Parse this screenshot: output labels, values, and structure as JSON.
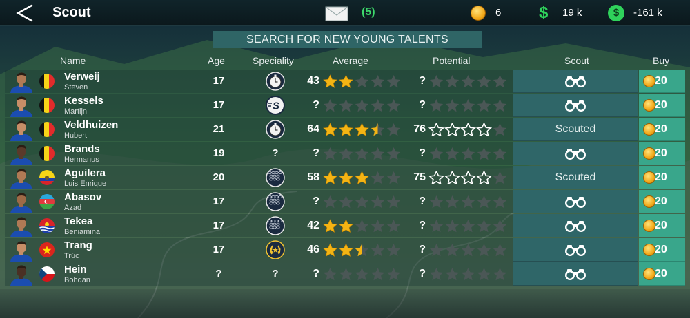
{
  "header": {
    "title": "Scout",
    "mail_count": "(5)",
    "coins": "6",
    "money": "19 k",
    "cash": "-161 k"
  },
  "search_button": "SEARCH FOR NEW YOUNG TALENTS",
  "columns": {
    "name": "Name",
    "age": "Age",
    "speciality": "Speciality",
    "average": "Average",
    "potential": "Potential",
    "scout": "Scout",
    "buy": "Buy"
  },
  "players": [
    {
      "last": "Verweij",
      "first": "Steven",
      "flag": "belgium",
      "age": "17",
      "spec": "stopwatch",
      "avg_value": "43",
      "avg_stars": 2,
      "pot_value": "?",
      "pot_stars": 0,
      "scout": "binoculars",
      "price": "20",
      "skin": "#b07a55",
      "shirt": "#1b4db0"
    },
    {
      "last": "Kessels",
      "first": "Martijn",
      "flag": "belgium",
      "age": "17",
      "spec": "sprint",
      "avg_value": "?",
      "avg_stars": 0,
      "pot_value": "?",
      "pot_stars": 0,
      "scout": "binoculars",
      "price": "20",
      "skin": "#c78e67",
      "shirt": "#1b4db0"
    },
    {
      "last": "Veldhuizen",
      "first": "Hubert",
      "flag": "belgium",
      "age": "21",
      "spec": "stopwatch",
      "avg_value": "64",
      "avg_stars": 3.5,
      "pot_value": "76",
      "pot_stars": 4,
      "scout": "Scouted",
      "price": "20",
      "skin": "#c78e67",
      "shirt": "#1b4db0"
    },
    {
      "last": "Brands",
      "first": "Hermanus",
      "flag": "belgium",
      "age": "19",
      "spec": "?",
      "avg_value": "?",
      "avg_stars": 0,
      "pot_value": "?",
      "pot_stars": 0,
      "scout": "binoculars",
      "price": "20",
      "skin": "#5a3a2a",
      "shirt": "#1b4db0"
    },
    {
      "last": "Aguilera",
      "first": "Luis Enrique",
      "flag": "ecuador",
      "age": "20",
      "spec": "cobbles",
      "avg_value": "58",
      "avg_stars": 3,
      "pot_value": "75",
      "pot_stars": 4,
      "scout": "Scouted",
      "price": "20",
      "skin": "#b07a55",
      "shirt": "#1b4db0"
    },
    {
      "last": "Abasov",
      "first": "Azad",
      "flag": "azerbaijan",
      "age": "17",
      "spec": "cobbles",
      "avg_value": "?",
      "avg_stars": 0,
      "pot_value": "?",
      "pot_stars": 0,
      "scout": "binoculars",
      "price": "20",
      "skin": "#9d6a47",
      "shirt": "#1b4db0"
    },
    {
      "last": "Tekea",
      "first": "Beniamina",
      "flag": "kiribati",
      "age": "17",
      "spec": "cobbles",
      "avg_value": "42",
      "avg_stars": 2,
      "pot_value": "?",
      "pot_stars": 0,
      "scout": "binoculars",
      "price": "20",
      "skin": "#b07a55",
      "shirt": "#1b4db0"
    },
    {
      "last": "Trang",
      "first": "Trúc",
      "flag": "vietnam",
      "age": "17",
      "spec": "laurel",
      "avg_value": "46",
      "avg_stars": 2.5,
      "pot_value": "?",
      "pot_stars": 0,
      "scout": "binoculars",
      "price": "20",
      "skin": "#c78e67",
      "shirt": "#1b4db0"
    },
    {
      "last": "Hein",
      "first": "Bohdan",
      "flag": "czech",
      "age": "?",
      "spec": "?",
      "avg_value": "?",
      "avg_stars": 0,
      "pot_value": "?",
      "pot_stars": 0,
      "scout": "binoculars",
      "price": "20",
      "skin": "#4a3024",
      "shirt": "#1b4db0"
    }
  ],
  "colors": {
    "gold_star": "#f4b414",
    "empty_star": "#4b5756",
    "scout_cell": "#2f6668",
    "buy_cell": "#39a68b",
    "mail_count": "#3dd86b"
  }
}
